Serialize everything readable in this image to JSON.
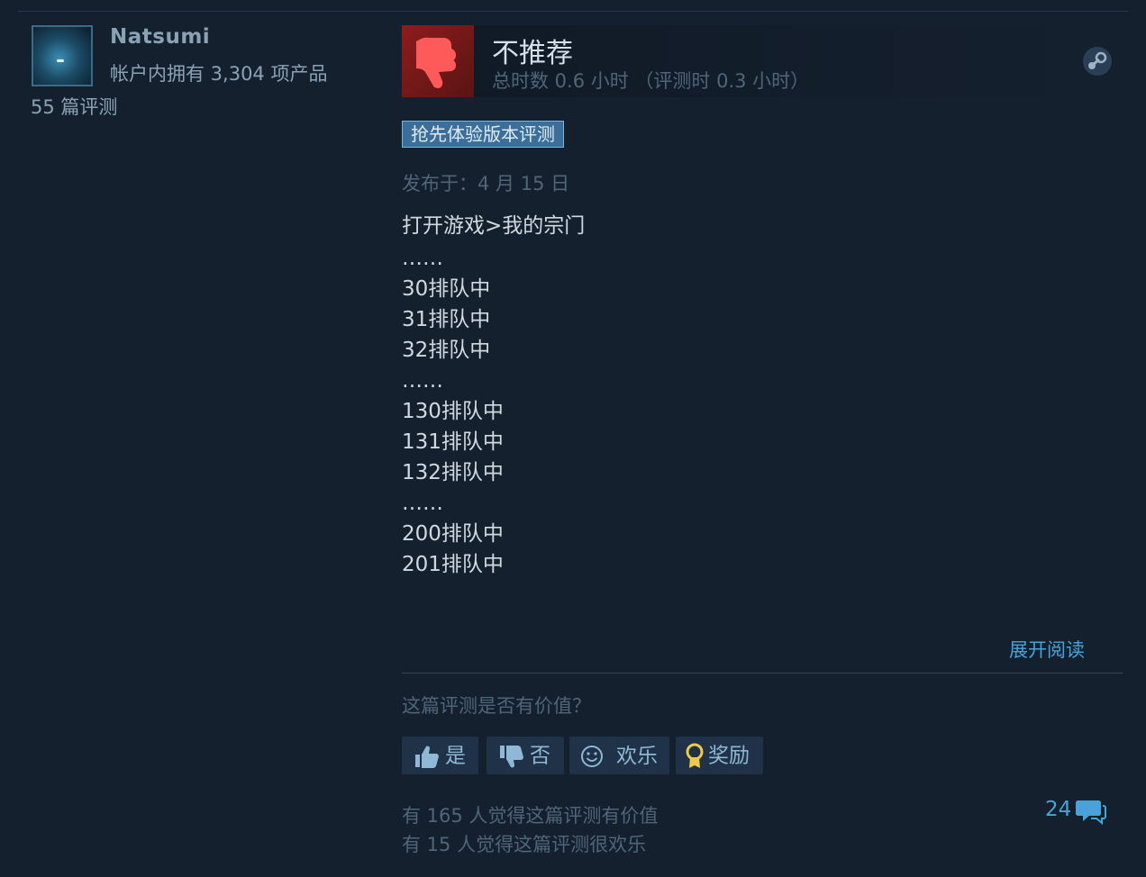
{
  "author": {
    "name": "Natsumi",
    "products_owned": "帐户内拥有 3,304 项产品",
    "review_count": "55 篇评测"
  },
  "review": {
    "verdict": "不推荐",
    "hours": "总时数 0.6 小时 （评测时 0.3 小时）",
    "badge": "抢先体验版本评测",
    "posted": "发布于：4 月 15 日",
    "lines": [
      "打开游戏>我的宗门",
      "……",
      "30排队中",
      "31排队中",
      "32排队中",
      "……",
      "130排队中",
      "131排队中",
      "132排队中",
      "……",
      "200排队中",
      "201排队中"
    ],
    "expand_label": "展开阅读"
  },
  "feedback": {
    "question": "这篇评测是否有价值？",
    "buttons": {
      "yes": "是",
      "no": "否",
      "funny": "欢乐",
      "award": "奖励"
    },
    "helpful_count_text": "有 165 人觉得这篇评测有价值",
    "funny_count_text": "有 15 人觉得这篇评测很欢乐",
    "comment_count": "24"
  },
  "icons": {
    "verdict": "thumbs-down-icon",
    "platform": "steam-icon",
    "yes": "thumbs-up-icon",
    "no": "thumbs-down-icon",
    "funny": "smiley-icon",
    "award": "award-ribbon-icon",
    "comments": "comment-bubble-icon"
  },
  "colors": {
    "background": "#15202f",
    "verdict_bg": "#8e1c1c",
    "thumb_down": "#ff5a5a",
    "link": "#4aa2d9",
    "badge_bg": "#3b6e98",
    "award": "#f2c94c"
  }
}
